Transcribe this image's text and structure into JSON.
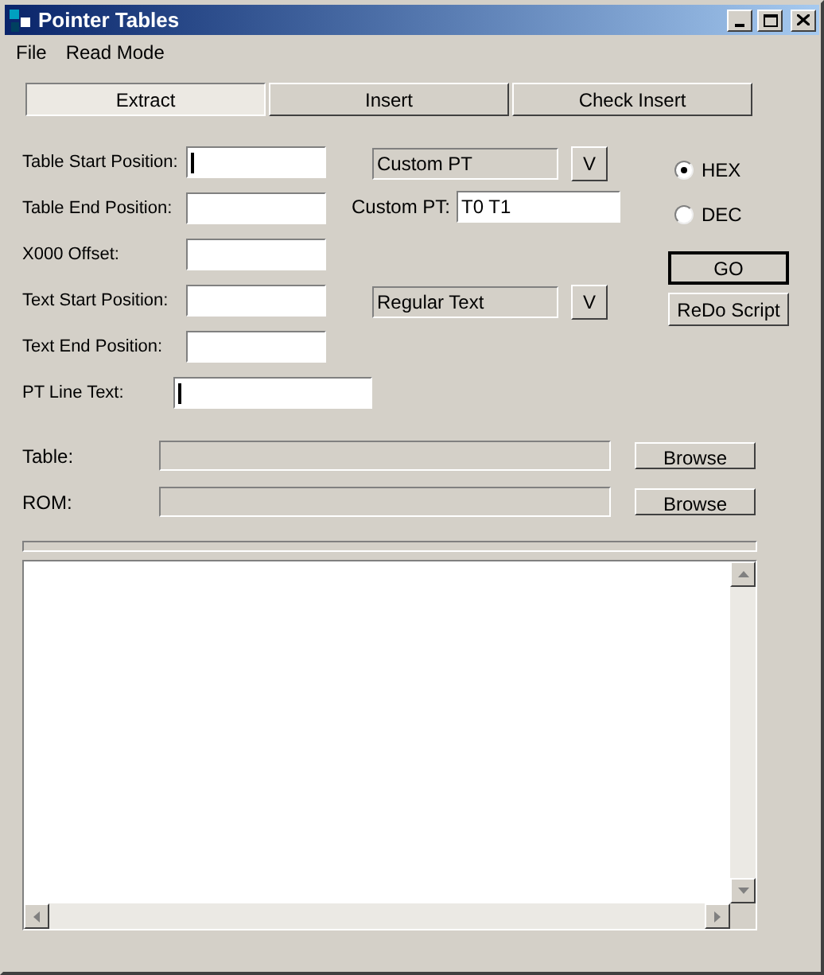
{
  "window": {
    "title": "Pointer Tables"
  },
  "menu": [
    "File",
    "Read Mode"
  ],
  "tabs": [
    {
      "label": "Extract",
      "selected": true
    },
    {
      "label": "Insert",
      "selected": false
    },
    {
      "label": "Check Insert",
      "selected": false
    }
  ],
  "fields": [
    {
      "label": "Table Start Position:",
      "focused": true
    },
    {
      "label": "Table End Position:",
      "focused": false
    },
    {
      "label": "X000 Offset:",
      "focused": false
    },
    {
      "label": "Text Start Position:",
      "focused": false
    },
    {
      "label": "Text End Position:",
      "focused": false
    },
    {
      "label": "PT Line Text:",
      "focused": true,
      "wide": true
    }
  ],
  "pt_mode": {
    "value": "Custom PT",
    "button": "V"
  },
  "custom_pt": {
    "label": "Custom PT:",
    "value": "T0 T1"
  },
  "text_mode": {
    "value": "Regular Text",
    "button": "V"
  },
  "radios": [
    {
      "label": "HEX",
      "selected": true
    },
    {
      "label": "DEC",
      "selected": false
    }
  ],
  "actions": [
    {
      "label": "GO",
      "default": true
    },
    {
      "label": "ReDo Script",
      "default": false
    }
  ],
  "files": [
    {
      "label": "Table:",
      "button": "Browse"
    },
    {
      "label": "ROM:",
      "button": "Browse"
    }
  ]
}
